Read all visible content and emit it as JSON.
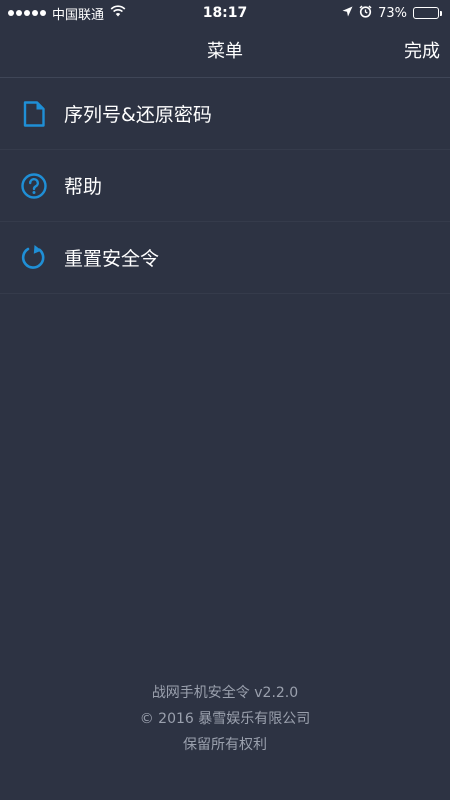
{
  "status_bar": {
    "carrier": "中国联通",
    "time": "18:17",
    "battery_percent": "73%",
    "battery_level": 0.73,
    "icons": [
      "signal-dots",
      "wifi-icon",
      "location-arrow-icon",
      "alarm-clock-icon",
      "battery-icon"
    ]
  },
  "nav": {
    "title": "菜单",
    "done_label": "完成"
  },
  "menu": {
    "items": [
      {
        "label": "序列号&还原密码",
        "icon": "document-icon"
      },
      {
        "label": "帮助",
        "icon": "question-circle-icon"
      },
      {
        "label": "重置安全令",
        "icon": "refresh-icon"
      }
    ]
  },
  "footer": {
    "app_version": "战网手机安全令 v2.2.0",
    "copyright": "© 2016 暴雪娱乐有限公司",
    "rights": "保留所有权利"
  },
  "colors": {
    "background": "#2d3343",
    "accent": "#1f8fd6",
    "divider": "#353b4b",
    "footer_text": "#9aa0ad"
  }
}
